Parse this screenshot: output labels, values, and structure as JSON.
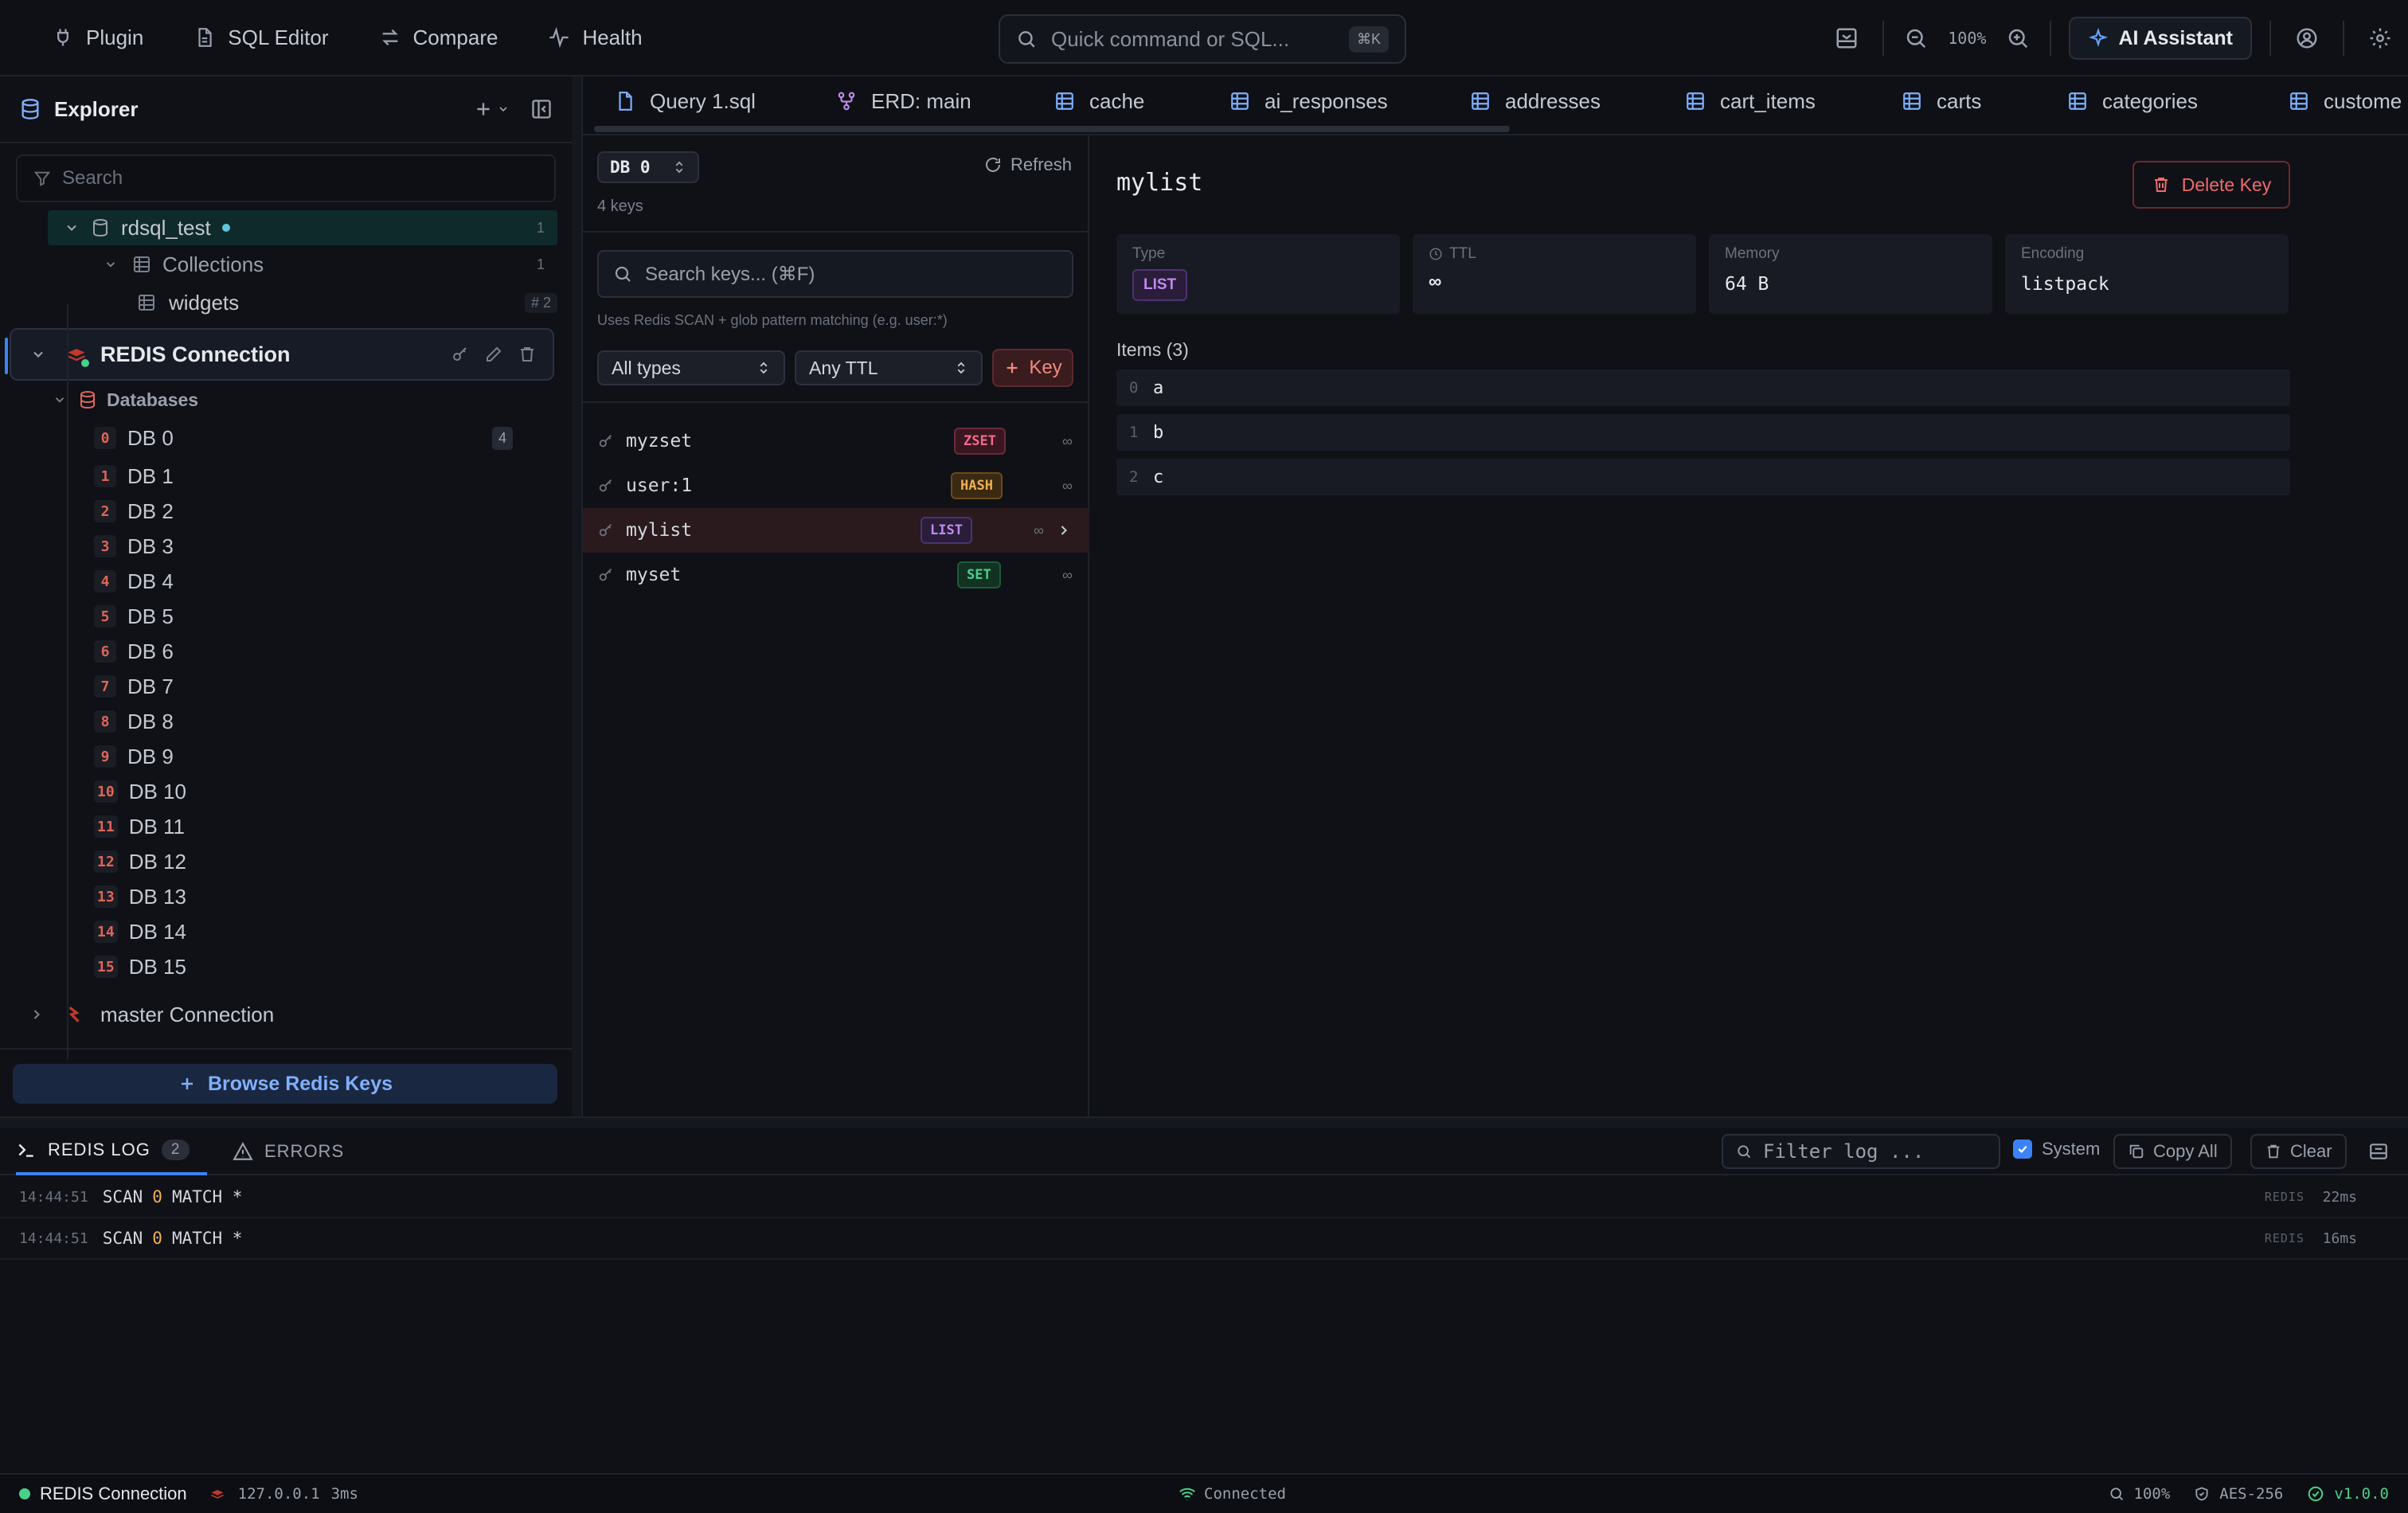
{
  "topnav": {
    "items": [
      {
        "label": "Plugin",
        "icon": "plugin-icon"
      },
      {
        "label": "SQL Editor",
        "icon": "document-icon"
      },
      {
        "label": "Compare",
        "icon": "compare-icon"
      },
      {
        "label": "Health",
        "icon": "activity-icon"
      }
    ],
    "quick_command_placeholder": "Quick command or SQL...",
    "quick_command_shortcut": "⌘K",
    "zoom": "100%",
    "ai_label": "AI Assistant"
  },
  "sidebar": {
    "title": "Explorer",
    "search_placeholder": "Search",
    "tree": {
      "schema_name": "rdsql_test",
      "schema_count": "1",
      "collections_label": "Collections",
      "collections_count": "1",
      "collection_item": "widgets",
      "collection_item_count": "# 2"
    },
    "redis_connection": {
      "label": "REDIS Connection",
      "databases_label": "Databases",
      "databases": [
        {
          "idx": "0",
          "label": "DB 0",
          "count": "4"
        },
        {
          "idx": "1",
          "label": "DB 1"
        },
        {
          "idx": "2",
          "label": "DB 2"
        },
        {
          "idx": "3",
          "label": "DB 3"
        },
        {
          "idx": "4",
          "label": "DB 4"
        },
        {
          "idx": "5",
          "label": "DB 5"
        },
        {
          "idx": "6",
          "label": "DB 6"
        },
        {
          "idx": "7",
          "label": "DB 7"
        },
        {
          "idx": "8",
          "label": "DB 8"
        },
        {
          "idx": "9",
          "label": "DB 9"
        },
        {
          "idx": "10",
          "label": "DB 10"
        },
        {
          "idx": "11",
          "label": "DB 11"
        },
        {
          "idx": "12",
          "label": "DB 12"
        },
        {
          "idx": "13",
          "label": "DB 13"
        },
        {
          "idx": "14",
          "label": "DB 14"
        },
        {
          "idx": "15",
          "label": "DB 15"
        }
      ]
    },
    "master_connection": "master Connection",
    "browse_label": "Browse Redis Keys"
  },
  "tabs": [
    {
      "label": "Query 1.sql",
      "icon": "file-icon"
    },
    {
      "label": "ERD: main",
      "icon": "erd-icon"
    },
    {
      "label": "cache",
      "icon": "table-icon"
    },
    {
      "label": "ai_responses",
      "icon": "table-icon"
    },
    {
      "label": "addresses",
      "icon": "table-icon"
    },
    {
      "label": "cart_items",
      "icon": "table-icon"
    },
    {
      "label": "carts",
      "icon": "table-icon"
    },
    {
      "label": "categories",
      "icon": "table-icon"
    },
    {
      "label": "custome",
      "icon": "table-icon"
    }
  ],
  "keys_panel": {
    "db_selected": "DB 0",
    "refresh_label": "Refresh",
    "keys_count": "4 keys",
    "search_placeholder": "Search keys... (⌘F)",
    "scan_hint": "Uses Redis SCAN + glob pattern matching (e.g. user:*)",
    "type_filter": "All types",
    "ttl_filter": "Any TTL",
    "add_key_label": "Key",
    "keys": [
      {
        "name": "myzset",
        "type": "ZSET",
        "ttl": "∞"
      },
      {
        "name": "user:1",
        "type": "HASH",
        "ttl": "∞"
      },
      {
        "name": "mylist",
        "type": "LIST",
        "ttl": "∞"
      },
      {
        "name": "myset",
        "type": "SET",
        "ttl": "∞"
      }
    ]
  },
  "detail": {
    "key_name": "mylist",
    "delete_label": "Delete Key",
    "type_label": "Type",
    "type_value": "LIST",
    "ttl_label": "TTL",
    "ttl_value": "∞",
    "memory_label": "Memory",
    "memory_value": "64 B",
    "encoding_label": "Encoding",
    "encoding_value": "listpack",
    "items_label": "Items (3)",
    "items": [
      {
        "idx": "0",
        "value": "a"
      },
      {
        "idx": "1",
        "value": "b"
      },
      {
        "idx": "2",
        "value": "c"
      }
    ]
  },
  "log": {
    "redis_tab": "REDIS LOG",
    "redis_count": "2",
    "errors_tab": "ERRORS",
    "filter_placeholder": "Filter log ...",
    "system_label": "System",
    "copy_all": "Copy All",
    "clear": "Clear",
    "lines": [
      {
        "time": "14:44:51",
        "cmd": "SCAN",
        "arg": "0",
        "rest": "MATCH *",
        "src": "REDIS",
        "ms": "22ms"
      },
      {
        "time": "14:44:51",
        "cmd": "SCAN",
        "arg": "0",
        "rest": "MATCH *",
        "src": "REDIS",
        "ms": "16ms"
      }
    ]
  },
  "status": {
    "connection": "REDIS Connection",
    "host": "127.0.0.1",
    "latency": "3ms",
    "state": "Connected",
    "zoom": "100%",
    "encryption": "AES-256",
    "version": "v1.0.0"
  },
  "colors": {
    "accent": "#3b82f6",
    "redis": "#e0645a",
    "connected": "#4ad08a"
  }
}
